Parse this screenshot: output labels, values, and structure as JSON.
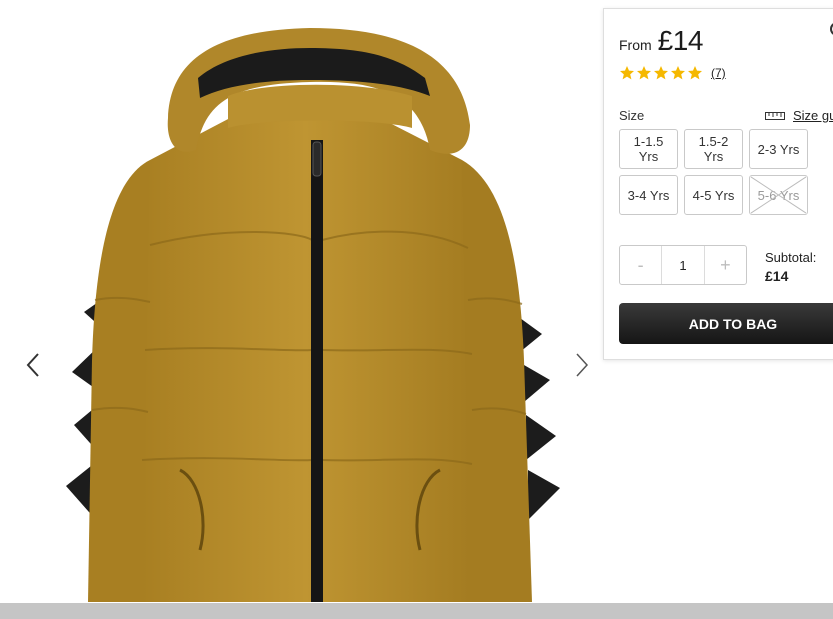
{
  "product": {
    "from_label": "From",
    "price": "£14",
    "rating_stars": 5,
    "review_count": "(7)"
  },
  "size_section": {
    "label": "Size",
    "guide_label": "Size gu",
    "options": [
      {
        "label": "1-1.5 Yrs",
        "available": true
      },
      {
        "label": "1.5-2 Yrs",
        "available": true
      },
      {
        "label": "2-3 Yrs",
        "available": true
      },
      {
        "label": "3-4 Yrs",
        "available": true
      },
      {
        "label": "4-5 Yrs",
        "available": true
      },
      {
        "label": "5-6 Yrs",
        "available": false
      }
    ]
  },
  "quantity": {
    "minus": "-",
    "value": "1",
    "plus": "+"
  },
  "subtotal": {
    "label": "Subtotal:",
    "value": "£14"
  },
  "actions": {
    "add_to_bag": "ADD TO BAG"
  },
  "gallery": {
    "prev_icon": "chevron-left-icon",
    "next_icon": "chevron-right-icon"
  },
  "colors": {
    "jacket": "#b38a2a",
    "star": "#f5b800",
    "button": "#1f1f1f"
  }
}
